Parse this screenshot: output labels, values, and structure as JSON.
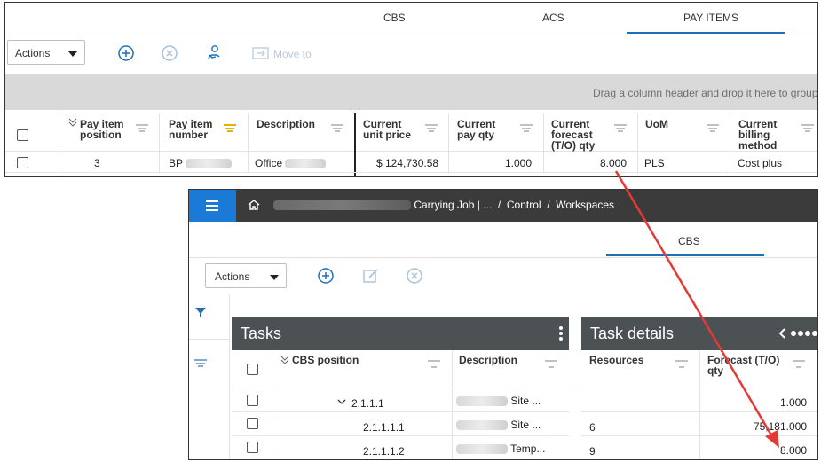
{
  "top_panel": {
    "tabs": [
      "CBS",
      "ACS",
      "PAY ITEMS"
    ],
    "active_tab": "PAY ITEMS",
    "toolbar": {
      "actions_label": "Actions",
      "move_to_label": "Move to"
    },
    "group_hint": "Drag a column header and drop it here to group",
    "columns": [
      {
        "label": "Pay item\nposition"
      },
      {
        "label": "Pay item\nnumber"
      },
      {
        "label": "Description"
      },
      {
        "label": "Current\nunit price"
      },
      {
        "label": "Current\npay qty"
      },
      {
        "label": "Current\nforecast\n(T/O) qty"
      },
      {
        "label": "UoM"
      },
      {
        "label": "Current\nbilling\nmethod"
      }
    ],
    "row": {
      "position": "3",
      "number": "BP",
      "description": "Office",
      "unit_price": "$ 124,730.58",
      "pay_qty": "1.000",
      "forecast_qty": "8.000",
      "uom": "PLS",
      "billing_method": "Cost plus"
    }
  },
  "bottom_panel": {
    "breadcrumb": {
      "job": "Carrying Job | ...",
      "control": "Control",
      "workspaces": "Workspaces",
      "separator": "/"
    },
    "tabs": [
      "CBS"
    ],
    "toolbar": {
      "actions_label": "Actions"
    },
    "tasks": {
      "title": "Tasks",
      "columns": [
        "CBS position",
        "Description"
      ],
      "rows": [
        {
          "position": "2.1.1.1",
          "description": "Site ..."
        },
        {
          "position": "2.1.1.1.1",
          "description": "Site ..."
        },
        {
          "position": "2.1.1.1.2",
          "description": "Temp..."
        }
      ]
    },
    "task_details": {
      "title": "Task details",
      "columns": [
        "Resources",
        "Forecast (T/O)\nqty"
      ],
      "rows": [
        {
          "resources": "",
          "forecast": "1.000"
        },
        {
          "resources": "6",
          "forecast": "75,181.000"
        },
        {
          "resources": "9",
          "forecast": "8.000"
        }
      ]
    }
  },
  "colors": {
    "accent_blue": "#1f6fb8",
    "menu_blue": "#1a7ad6",
    "topbar_dark": "#3b3b3b",
    "panel_header": "#4c5154",
    "arrow_red": "#e53935",
    "filter_active": "#e2b400"
  },
  "icons": [
    "add-circle-icon",
    "cancel-circle-icon",
    "assign-person-icon",
    "move-to-icon",
    "hamburger-icon",
    "home-icon",
    "edit-icon",
    "filter-icon",
    "more-vert-icon",
    "chevron-left-icon",
    "expand-icon"
  ]
}
